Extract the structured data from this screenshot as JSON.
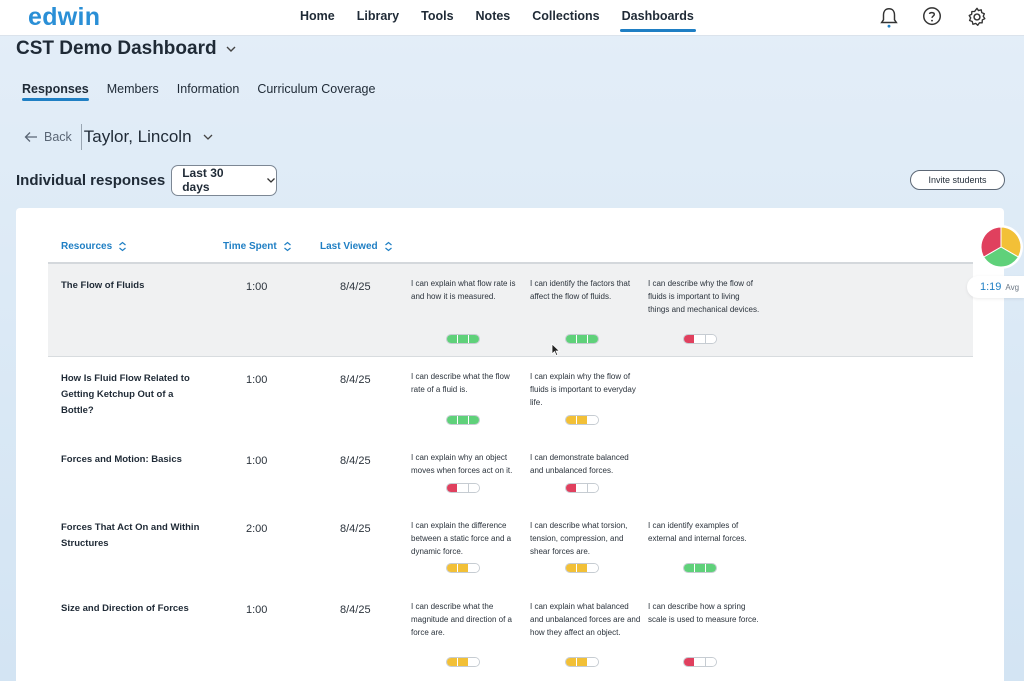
{
  "app": {
    "logo": "edwin"
  },
  "nav": {
    "items": [
      "Home",
      "Library",
      "Tools",
      "Notes",
      "Collections",
      "Dashboards"
    ],
    "active": "Dashboards"
  },
  "header_icons": [
    "bell-icon",
    "help-icon",
    "gear-icon"
  ],
  "dashboard": {
    "title": "CST Demo Dashboard"
  },
  "tabs": [
    "Responses",
    "Members",
    "Information",
    "Curriculum Coverage"
  ],
  "active_tab": "Responses",
  "back_label": "Back",
  "student": "Taylor, Lincoln",
  "responses": {
    "title": "Individual responses",
    "range": "Last 30 days",
    "invite_label": "Invite students"
  },
  "table": {
    "columns": [
      "Resources",
      "Time Spent",
      "Last Viewed"
    ],
    "rows": [
      {
        "resource": "The Flow of Fluids",
        "time": "1:00",
        "date": "8/4/25",
        "statements": [
          {
            "text": "I can explain what flow rate is and how it is measured.",
            "level": 3
          },
          {
            "text": "I can identify the factors that affect the flow of fluids.",
            "level": 3
          },
          {
            "text": "I can describe why the flow of fluids is important to living things and mechanical devices.",
            "level": 1
          }
        ]
      },
      {
        "resource": "How Is Fluid Flow Related to Getting Ketchup Out of a Bottle?",
        "time": "1:00",
        "date": "8/4/25",
        "statements": [
          {
            "text": "I can describe what the flow rate of a fluid is.",
            "level": 3
          },
          {
            "text": "I can explain why the flow of fluids is important to everyday life.",
            "level": 2
          }
        ]
      },
      {
        "resource": "Forces and Motion: Basics",
        "time": "1:00",
        "date": "8/4/25",
        "statements": [
          {
            "text": "I can explain why an object moves when forces act on it.",
            "level": 1
          },
          {
            "text": "I can demonstrate balanced and unbalanced forces.",
            "level": 1
          }
        ]
      },
      {
        "resource": "Forces That Act On and Within Structures",
        "time": "2:00",
        "date": "8/4/25",
        "statements": [
          {
            "text": "I can explain the difference between a static force and a dynamic force.",
            "level": 2
          },
          {
            "text": "I can describe what torsion, tension, compression, and shear forces are.",
            "level": 2
          },
          {
            "text": "I can identify examples of external and internal forces.",
            "level": 3
          }
        ]
      },
      {
        "resource": "Size and Direction of Forces",
        "time": "1:00",
        "date": "8/4/25",
        "statements": [
          {
            "text": "I can describe what the magnitude and direction of a force are.",
            "level": 2
          },
          {
            "text": "I can explain what balanced and unbalanced forces are and how they affect an object.",
            "level": 2
          },
          {
            "text": "I can describe how a spring scale is used to measure force.",
            "level": 1
          }
        ]
      }
    ]
  },
  "summary": {
    "avg_time": "1:19",
    "avg_label": "Avg"
  },
  "colors": {
    "accent": "#1f7fc4",
    "level_1": "#e0405e",
    "level_2": "#f2c037",
    "level_3": "#5fd17a",
    "pie": [
      "#e0405e",
      "#f2c037",
      "#5fd17a"
    ]
  }
}
